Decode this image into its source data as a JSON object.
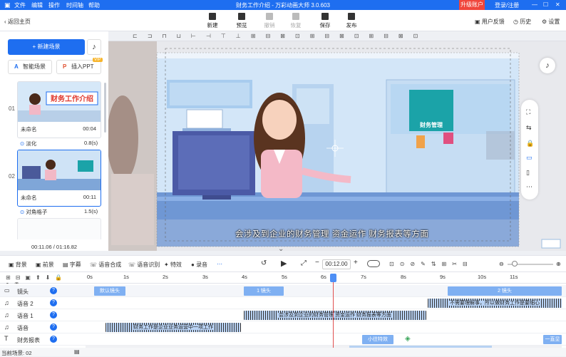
{
  "menu": {
    "items": [
      "文件",
      "编辑",
      "操作",
      "时间轴",
      "帮助"
    ]
  },
  "app_title": "财务工作介绍 - 万彩动画大师 3.0.603",
  "account": {
    "upgrade": "升级账户",
    "login": "登录/注册"
  },
  "toolbar": {
    "back": "返回主页",
    "buttons": [
      {
        "label": "新建",
        "enabled": true
      },
      {
        "label": "预览",
        "enabled": true
      },
      {
        "label": "撤销",
        "enabled": false
      },
      {
        "label": "恢复",
        "enabled": false
      },
      {
        "label": "保存",
        "enabled": true
      },
      {
        "label": "发布",
        "enabled": true
      }
    ],
    "right": [
      "用户反馈",
      "历史",
      "设置"
    ]
  },
  "left_panel": {
    "new_scene": "+ 新建场景",
    "smart_scene": "智能场景",
    "insert_ppt": "插入PPT",
    "vip": "VIP",
    "scenes": [
      {
        "num": "01",
        "name": "未命名",
        "duration": "00:04",
        "thumb_title": "财务工作介绍",
        "transition": "淡化",
        "transition_duration": "0.8(s)"
      },
      {
        "num": "02",
        "name": "未命名",
        "duration": "00:11",
        "transition": "对角格子",
        "transition_duration": "1.5(s)"
      }
    ],
    "time_current": "00:11.06",
    "time_total": "/ 01:16.82"
  },
  "canvas": {
    "subtitle": "会涉及到企业的财务管理 资金运作 财务报表等方面",
    "sign_text": "财务管理"
  },
  "bottom_toolbar": {
    "items": [
      "背景",
      "前景",
      "字幕",
      "语音合成",
      "语音识别",
      "特效",
      "录音"
    ],
    "timecode": "00:12.00"
  },
  "ruler": {
    "ticks": [
      "0s",
      "1s",
      "2s",
      "3s",
      "4s",
      "5s",
      "6s",
      "7s",
      "8s",
      "9s",
      "10s",
      "11s"
    ]
  },
  "tracks": [
    {
      "label": "镜头",
      "clips": [
        {
          "text": "默认镜头"
        },
        {
          "text": "1 镜头"
        },
        {
          "text": "2 镜头"
        }
      ]
    },
    {
      "label": "语音 2",
      "clips": [
        {
          "text": "不需要理解事，所以做财务工作是要细心"
        }
      ]
    },
    {
      "label": "语音 1",
      "clips": [
        {
          "text": "会涉及到企业的财务管理 资金运作 财务报表等方面"
        }
      ]
    },
    {
      "label": "语音",
      "clips": [
        {
          "text": "财务工作是企业业务运营中一项工作"
        }
      ]
    },
    {
      "label": "财务报表",
      "clips": [
        {
          "text": "小往特效"
        },
        {
          "text": "一直显"
        }
      ]
    }
  ],
  "footer": {
    "scene_count": "当前场景: 02"
  },
  "colors": {
    "brand": "#1e6ef0",
    "upgrade": "#f0463c",
    "playhead": "#e05050"
  }
}
